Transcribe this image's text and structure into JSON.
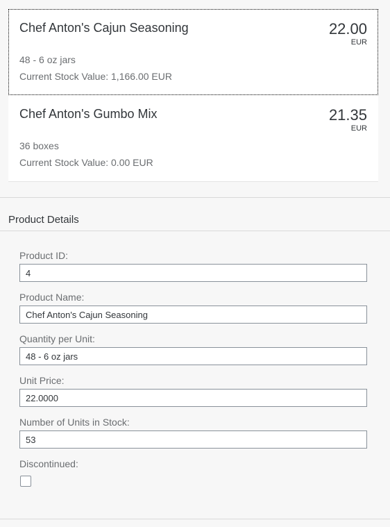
{
  "products": [
    {
      "name": "Chef Anton's Cajun Seasoning",
      "price": "22.00",
      "currency": "EUR",
      "quantity_per_unit": "48 - 6 oz jars",
      "stock_value": "Current Stock Value: 1,166.00 EUR"
    },
    {
      "name": "Chef Anton's Gumbo Mix",
      "price": "21.35",
      "currency": "EUR",
      "quantity_per_unit": "36 boxes",
      "stock_value": "Current Stock Value: 0.00 EUR"
    }
  ],
  "details": {
    "title": "Product Details",
    "product_id": {
      "label": "Product ID:",
      "value": "4"
    },
    "product_name": {
      "label": "Product Name:",
      "value": "Chef Anton's Cajun Seasoning"
    },
    "quantity_per_unit": {
      "label": "Quantity per Unit:",
      "value": "48 - 6 oz jars"
    },
    "unit_price": {
      "label": "Unit Price:",
      "value": "22.0000"
    },
    "units_in_stock": {
      "label": "Number of Units in Stock:",
      "value": "53"
    },
    "discontinued": {
      "label": "Discontinued:",
      "checked": false
    }
  },
  "colors": {
    "background": "#f7f7f7",
    "list_background": "#ffffff",
    "text": "#32363a",
    "secondary_text": "#6a6d70",
    "input_border": "#89919a"
  }
}
